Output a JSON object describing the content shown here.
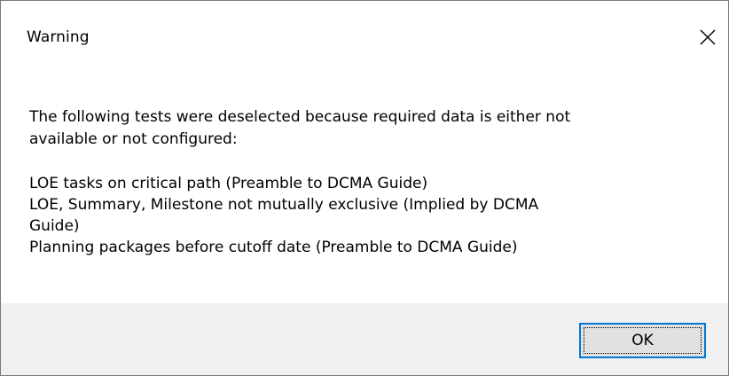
{
  "window": {
    "title": "Warning",
    "close_icon": "close-icon"
  },
  "message": {
    "intro_line1": "The following tests were deselected because required data is either not",
    "intro_line2": "available or not configured:",
    "items": [
      {
        "line1": "LOE tasks on critical path (Preamble to DCMA Guide)"
      },
      {
        "line1": "LOE, Summary, Milestone not mutually exclusive (Implied by DCMA",
        "line2": "Guide)"
      },
      {
        "line1": "Planning packages before cutoff date (Preamble to DCMA Guide)"
      }
    ]
  },
  "footer": {
    "ok_label": "OK"
  },
  "colors": {
    "footer_bg": "#f0f0f0",
    "button_bg": "#e1e1e1",
    "button_border_focus": "#0078d7"
  }
}
